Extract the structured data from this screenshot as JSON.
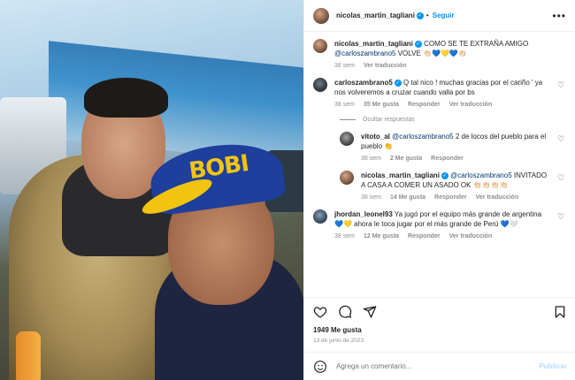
{
  "post": {
    "username": "nicolas_martin_tagliani",
    "follow_label": "Seguir",
    "separator": "•",
    "caption": {
      "username": "nicolas_martin_tagliani",
      "text": "COMO SE TE EXTRAÑA AMIGO",
      "mention": "@carloszambrano5",
      "text2": "VOLVE 👏🏻💙💛💙👏🏻",
      "time": "38 sem",
      "translate": "Ver traducción"
    }
  },
  "photo": {
    "cap_text": "BOBI"
  },
  "comments": [
    {
      "username": "carloszambrano5",
      "text": "Q tal nico ! muchas gracias por el cariño ' ya nos volveremos a cruzar cuando valla por bs",
      "time": "38 sem",
      "likes": "35 Me gusta",
      "reply": "Responder",
      "translate": "Ver traducción"
    }
  ],
  "hide_replies": "Ocultar respuestas",
  "replies": [
    {
      "username": "vitoto_al",
      "mention": "@carloszambrano5",
      "text": "2 de locos del pueblo para el pueblo 👏",
      "time": "38 sem",
      "likes": "2 Me gusta",
      "reply": "Responder",
      "translate": "Ver traducción"
    },
    {
      "username": "nicolas_martin_tagliani",
      "mention": "@carloszambrano5",
      "text": "INVITADO A CASA A COMER UN ASADO OK 👏🏻👏🏻👏🏻👏🏻",
      "time": "38 sem",
      "likes": "14 Me gusta",
      "reply": "Responder",
      "translate": "Ver traducción"
    }
  ],
  "comment2": {
    "username": "jhordan_leonel93",
    "text": "Ya jugó por el equipo más grande de argentina 💙💛 ahora le toca jugar por el más grande de Perú 💙🤍",
    "time": "38 sem",
    "likes": "12 Me gusta",
    "reply": "Responder",
    "translate": "Ver traducción"
  },
  "likes_count": "1949 Me gusta",
  "date": "13 de junio de 2023",
  "add_comment": {
    "placeholder": "Agrega un comentario...",
    "publish": "Publicar"
  }
}
